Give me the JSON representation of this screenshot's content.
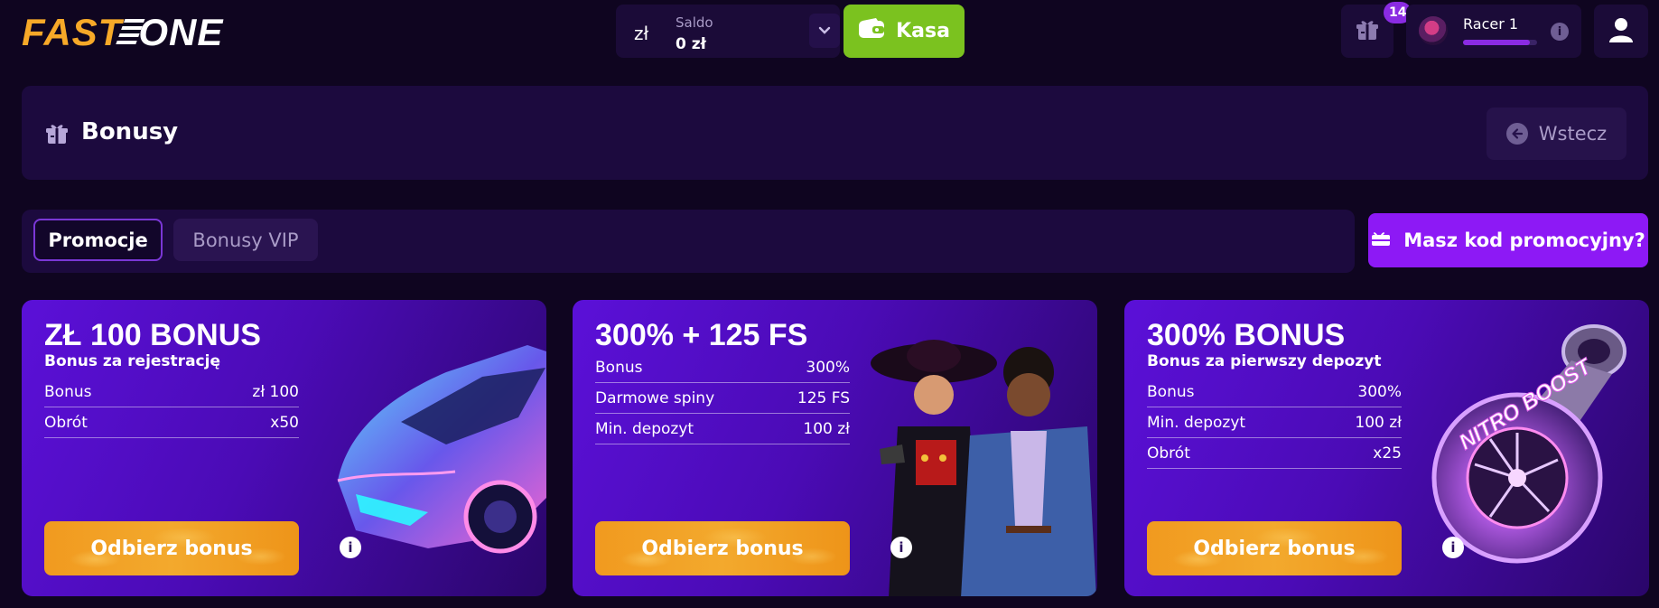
{
  "header": {
    "logo": {
      "part1": "FAST",
      "part2": "ONE"
    },
    "balance": {
      "currency": "zł",
      "label": "Saldo",
      "value": "0 zł"
    },
    "cashier_label": "Kasa",
    "gifts_count": "14",
    "profile": {
      "name": "Racer 1",
      "level_progress": 0.9
    }
  },
  "page": {
    "title": "Bonusy",
    "back_label": "Wstecz"
  },
  "tabs": [
    {
      "label": "Promocje",
      "active": true
    },
    {
      "label": "Bonusy VIP",
      "active": false
    }
  ],
  "promo_button_label": "Masz kod promocyjny?",
  "cards": [
    {
      "title": "ZŁ 100 BONUS",
      "subtitle": "Bonus za rejestrację",
      "rows": [
        {
          "label": "Bonus",
          "value": "zł 100"
        },
        {
          "label": "Obrót",
          "value": "x50"
        }
      ],
      "button": "Odbierz bonus",
      "art": "sports-car-image"
    },
    {
      "title": "300% + 125 FS",
      "subtitle": "",
      "rows": [
        {
          "label": "Bonus",
          "value": "300%"
        },
        {
          "label": "Darmowe spiny",
          "value": "125 FS"
        },
        {
          "label": "Min. depozyt",
          "value": "100 zł"
        }
      ],
      "button": "Odbierz bonus",
      "art": "detective-characters-image"
    },
    {
      "title": "300% BONUS",
      "subtitle": "Bonus za pierwszy depozyt",
      "rows": [
        {
          "label": "Bonus",
          "value": "300%"
        },
        {
          "label": "Min. depozyt",
          "value": "100 zł"
        },
        {
          "label": "Obrót",
          "value": "x25"
        }
      ],
      "button": "Odbierz bonus",
      "art": "turbocharger-image",
      "art_text": "NITRO BOOST"
    }
  ],
  "colors": {
    "background": "#0f0520",
    "panel": "#1c0a3e",
    "accent_purple": "#8d19f5",
    "cashier_green": "#7bc21f",
    "claim_orange": "#f3a92d",
    "logo_orange": "#f7a928"
  }
}
